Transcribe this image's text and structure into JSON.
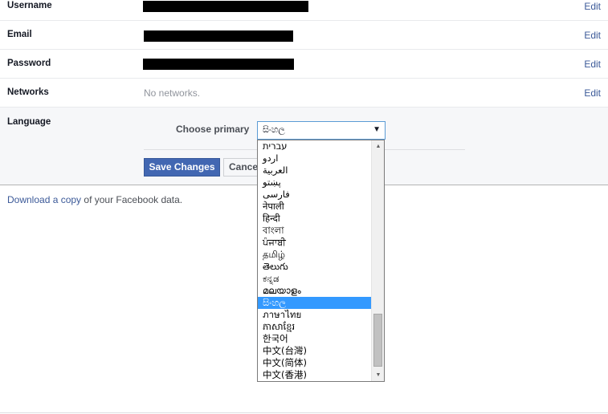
{
  "settings": {
    "username": {
      "label": "Username",
      "edit": "Edit"
    },
    "email": {
      "label": "Email",
      "edit": "Edit"
    },
    "password": {
      "label": "Password",
      "edit": "Edit"
    },
    "networks": {
      "label": "Networks",
      "value": "No networks.",
      "edit": "Edit"
    }
  },
  "language": {
    "label": "Language",
    "choose_primary": "Choose primary",
    "selected": "සිංහල",
    "options": [
      "עברית",
      "اردو",
      "العربية",
      "پښتو",
      "فارسی",
      "नेपाली",
      "हिन्दी",
      "বাংলা",
      "ਪੰਜਾਬੀ",
      "தமிழ்",
      "తెలుగు",
      "ಕನ್ನಡ",
      "മലയാളം",
      "සිංහල",
      "ภาษาไทย",
      "ភាសាខ្មែរ",
      "한국어",
      "中文(台灣)",
      "中文(简体)",
      "中文(香港)"
    ],
    "selected_index": 13,
    "scroll_position": 0.78,
    "save_label": "Save Changes",
    "cancel_label": "Cancel"
  },
  "download": {
    "prefix": "Download a copy",
    "suffix": " of your Facebook data."
  },
  "colors": {
    "link": "#3b5998",
    "primary_button": "#4267b2",
    "selection": "#3399ff"
  }
}
